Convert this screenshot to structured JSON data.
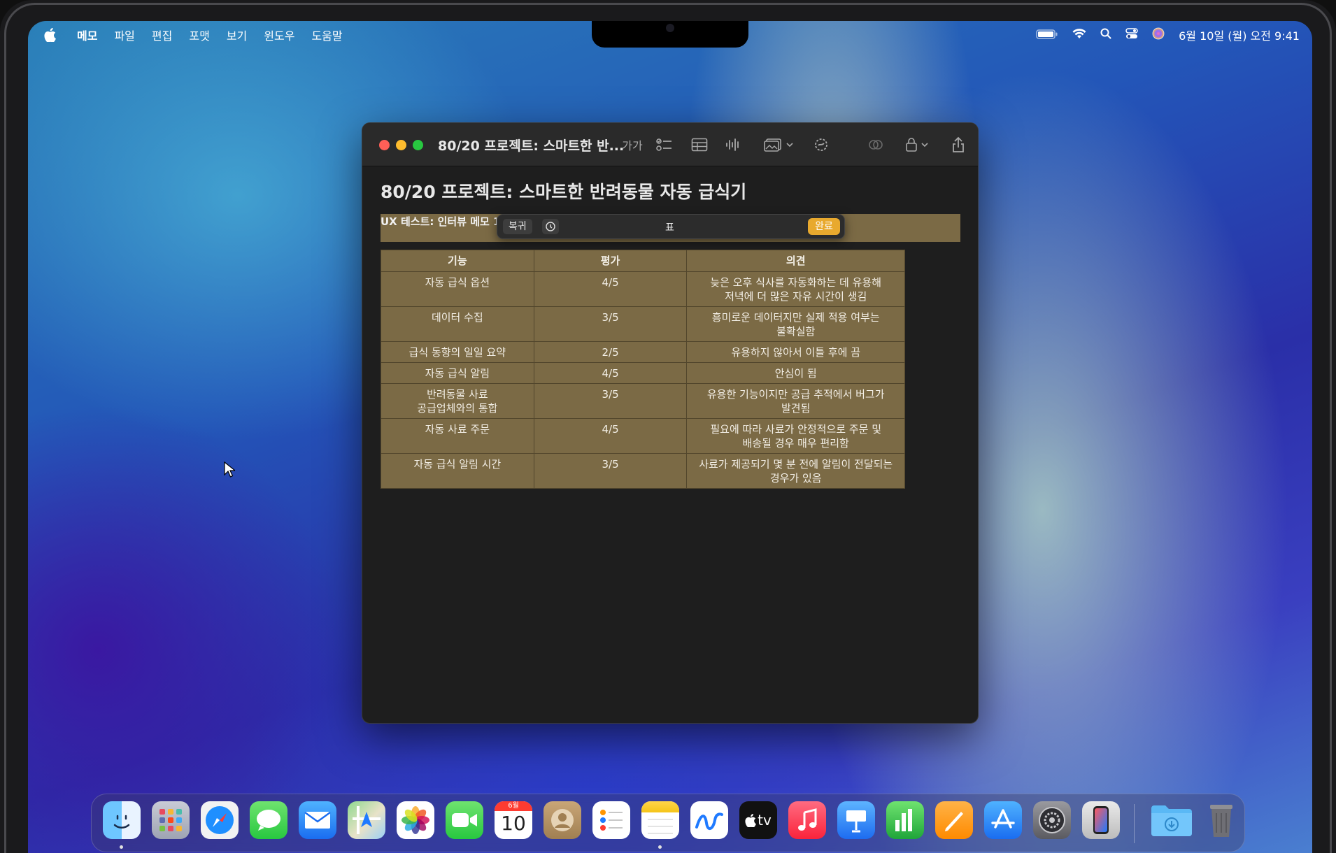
{
  "menubar": {
    "app": "메모",
    "items": [
      "파일",
      "편집",
      "포맷",
      "보기",
      "윈도우",
      "도움말"
    ],
    "clock": "6월 10일 (월) 오전 9:41"
  },
  "window": {
    "title": "80/20 프로젝트: 스마트한 반...",
    "toolbar": {
      "font_button": "가가"
    }
  },
  "note": {
    "title": "80/20 프로젝트: 스마트한 반려동물 자동 급식기",
    "subheading": "UX 테스트: 인터뷰 메모 12"
  },
  "popover": {
    "revert": "복귀",
    "label": "표",
    "done": "완료"
  },
  "table": {
    "headers": [
      "기능",
      "평가",
      "의견"
    ],
    "rows": [
      [
        "자동 급식 옵션",
        "4/5",
        "늦은 오후 식사를 자동화하는 데 유용해\n저녁에 더 많은 자유 시간이 생김"
      ],
      [
        "데이터 수집",
        "3/5",
        "흥미로운 데이터지만 실제 적용 여부는\n불확실함"
      ],
      [
        "급식 동향의 일일 요약",
        "2/5",
        "유용하지 않아서 이틀 후에 끔"
      ],
      [
        "자동 급식 알림",
        "4/5",
        "안심이 됨"
      ],
      [
        "반려동물 사료\n공급업체와의 통합",
        "3/5",
        "유용한 기능이지만 공급 추적에서 버그가\n발견됨"
      ],
      [
        "자동 사료 주문",
        "4/5",
        "필요에 따라 사료가 안정적으로 주문 및\n배송될 경우 매우 편리함"
      ],
      [
        "자동 급식 알림 시간",
        "3/5",
        "사료가 제공되기 몇 분 전에 알림이 전달되는\n경우가 있음"
      ]
    ]
  },
  "dock": {
    "calendar_month": "6월",
    "calendar_day": "10",
    "tv_label": "tv"
  },
  "colors": {
    "table_bg": "#7b6a45",
    "done_accent": "#e8a92e",
    "window_bg": "#1e1e1e"
  }
}
